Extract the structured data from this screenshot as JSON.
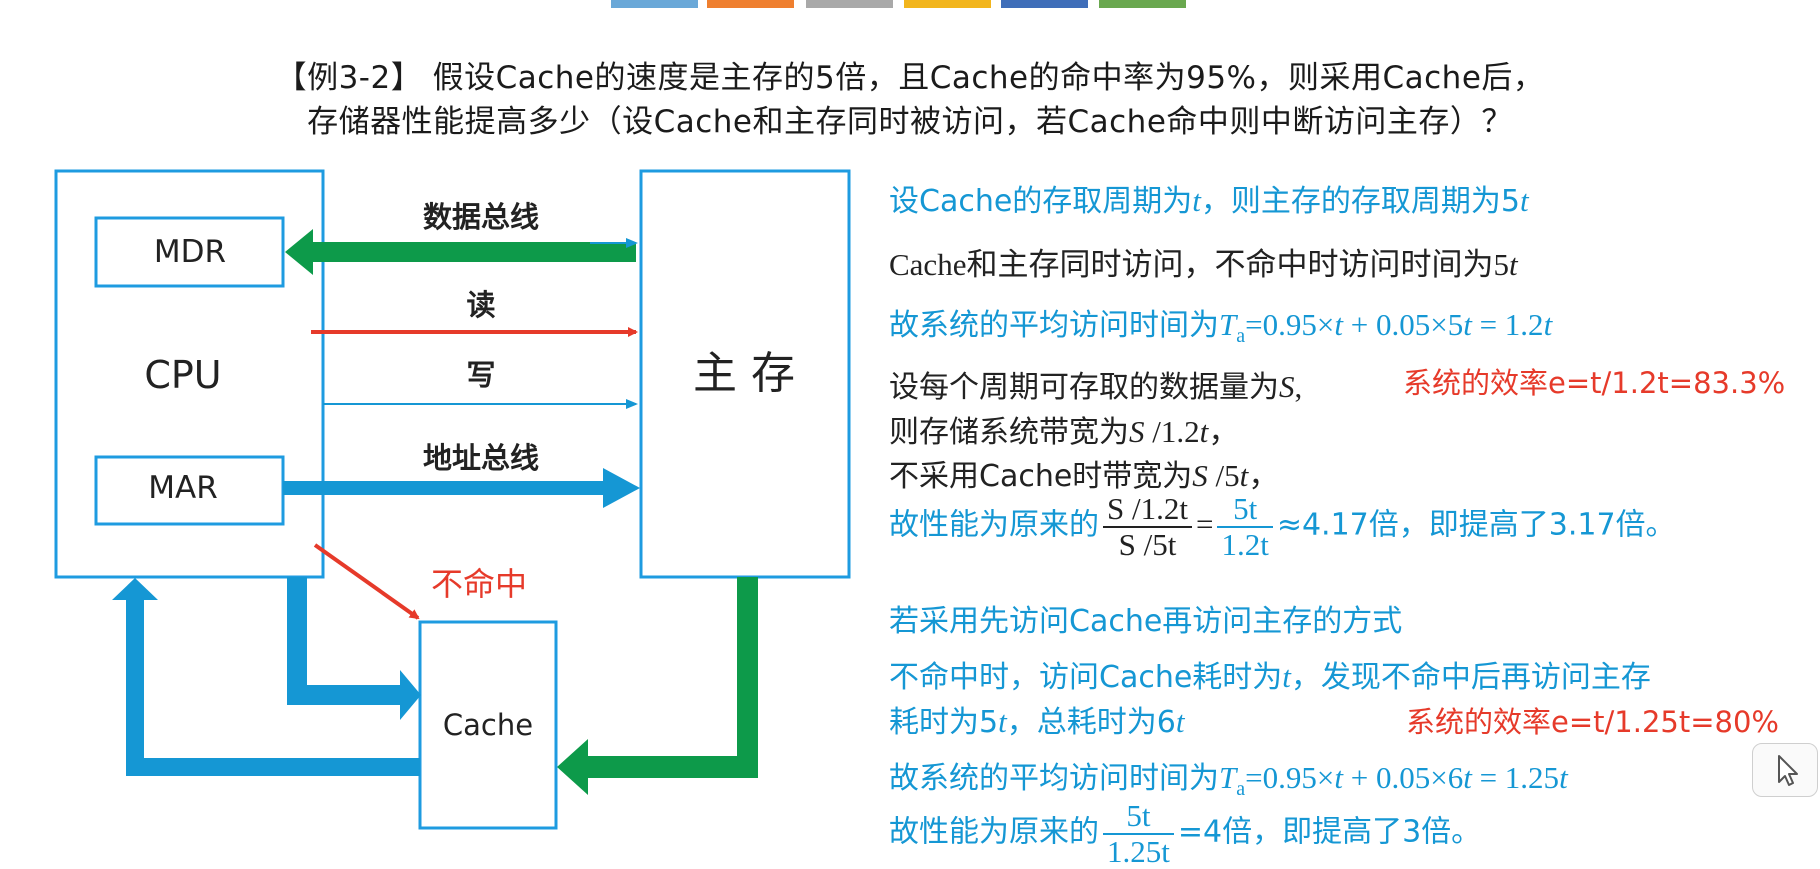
{
  "colors": {
    "blue": "#1597d4",
    "green": "#0d9a4a",
    "red": "#e63a2a",
    "box_border": "#1e9be0",
    "top_strip": [
      "#6aa8d8",
      "#ef7f2f",
      "#a9a9a9",
      "#f2b51d",
      "#3f6eb9",
      "#6aa84f"
    ]
  },
  "title": {
    "line1": "【例3-2】 假设Cache的速度是主存的5倍，且Cache的命中率为95%，则采用Cache后，",
    "line2": "存储器性能提高多少（设Cache和主存同时被访问，若Cache命中则中断访问主存）？"
  },
  "diagram": {
    "cpu": "CPU",
    "mdr": "MDR",
    "mar": "MAR",
    "main_memory": "主  存",
    "cache": "Cache",
    "data_bus": "数据总线",
    "read": "读",
    "write": "写",
    "address_bus": "地址总线",
    "miss": "不命中"
  },
  "solution": {
    "l1a": "设Cache的存取周期为",
    "l1b": "t",
    "l1c": "，则主存的存取周期为5",
    "l1d": "t",
    "l2a": "Cache和主存同时访问，不命中时访问时间为5",
    "l2b": "t",
    "l3a": "故系统的平均访问时间为",
    "l3b": "T",
    "l3c": "a",
    "l3d": "=0.95×",
    "l3e": "t",
    "l3f": " + 0.05×5",
    "l3g": "t",
    "l3h": " = 1.2",
    "l3i": "t",
    "l4a": "设每个周期可存取的数据量为",
    "l4b": "S",
    "l4c": ",",
    "l4red": "系统的效率e=t/1.2t=83.3%",
    "l5a": "则存储系统带宽为",
    "l5b": "S",
    "l5c": " /1.2",
    "l5d": "t",
    "l5e": "，",
    "l6a": "不采用Cache时带宽为",
    "l6b": "S",
    "l6c": " /5",
    "l6d": "t",
    "l6e": "，",
    "l7a": "故性能为原来的",
    "l7num": "S /1.2t",
    "l7den": "S /5t",
    "l7eq": "=",
    "l7num2": "5t",
    "l7den2": "1.2t",
    "l7b": "≈4.17倍，即提高了3.17倍。",
    "l8": "若采用先访问Cache再访问主存的方式",
    "l9a": "不命中时，访问Cache耗时为",
    "l9b": "t",
    "l9c": "，发现不命中后再访问主存",
    "l10a": "耗时为5",
    "l10b": "t",
    "l10c": "，总耗时为6",
    "l10d": "t",
    "l10red": "系统的效率e=t/1.25t=80%",
    "l11a": "故系统的平均访问时间为",
    "l11b": "T",
    "l11c": "a",
    "l11d": "=0.95×",
    "l11e": "t",
    "l11f": " + 0.05×6",
    "l11g": "t",
    "l11h": " = 1.25",
    "l11i": "t",
    "l12a": "故性能为原来的",
    "l12num": "5t",
    "l12den": "1.25t",
    "l12b": "=4倍，即提高了3倍。"
  },
  "icons": {
    "cursor": "cursor-arrow-icon"
  }
}
